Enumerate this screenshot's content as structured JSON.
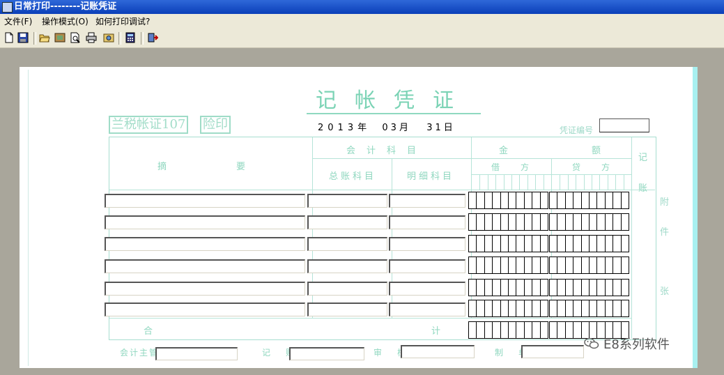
{
  "window": {
    "title": "日常打印--------记账凭证"
  },
  "menu": [
    {
      "label": "文件(F)"
    },
    {
      "label": "操作模式(O)"
    },
    {
      "label": "如何打印调试?"
    }
  ],
  "toolbar": {
    "icons": [
      "new-icon",
      "save-icon",
      "open-icon",
      "settings-icon",
      "print-preview-icon",
      "print-icon",
      "export-icon",
      "calculator-icon",
      "exit-icon"
    ]
  },
  "voucher": {
    "title": "记帐凭证",
    "label_left": "兰税帐证107",
    "label_stamp": "险印",
    "date": {
      "year": "2013",
      "year_unit": "年",
      "month": "03",
      "month_unit": "月",
      "day": "31",
      "day_unit": "日"
    },
    "cert_no_label": "凭证编号",
    "headers": {
      "summary": "摘要",
      "account": "会计科目",
      "general_account": "总账科目",
      "detail_account": "明细科目",
      "amount": "金额",
      "debit": "借方",
      "credit": "贷方",
      "posted": "记账"
    },
    "total_label_left": "合",
    "total_label_right": "计",
    "attach": [
      "附",
      "件",
      "张"
    ],
    "footer": [
      "会计主管",
      "记账",
      "审核",
      "制单"
    ]
  },
  "watermark": {
    "text": "E8系列软件"
  },
  "colors": {
    "titlebar": "#0a3fb8",
    "form_ink": "#8fd7bf",
    "workspace": "#a9a69b"
  }
}
